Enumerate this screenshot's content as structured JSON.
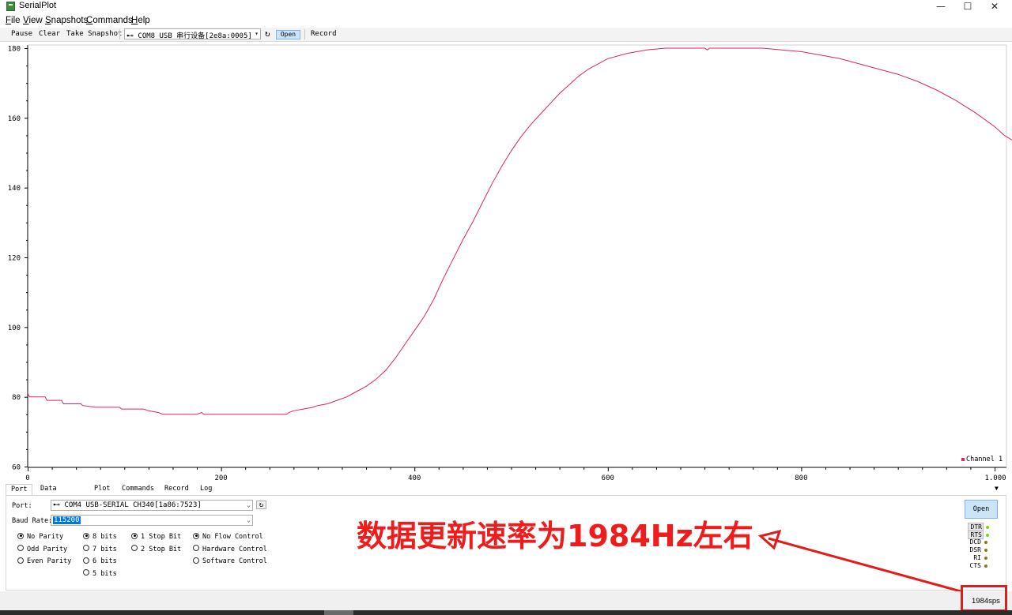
{
  "window": {
    "title": "SerialPlot",
    "min_glyph": "—",
    "max_glyph": "☐",
    "close_glyph": "✕"
  },
  "menu": [
    "File",
    "View",
    "Snapshots",
    "Commands",
    "Help"
  ],
  "toolbar": {
    "pause": "Pause",
    "clear": "Clear",
    "snapshot": "Take Snapshot",
    "port_combo": "⊷ COM8 USB 串行设备[2e8a:0005]",
    "refresh_glyph": "↻",
    "open": "Open",
    "record": "Record"
  },
  "chart_data": {
    "type": "line",
    "xlim": [
      0,
      1000
    ],
    "ylim": [
      60,
      180
    ],
    "x_ticks": [
      0,
      200,
      400,
      600,
      800
    ],
    "x_tick_labels": [
      "0",
      "200",
      "400",
      "600",
      "800",
      "1.000"
    ],
    "y_ticks": [
      60,
      80,
      100,
      120,
      140,
      160,
      180
    ],
    "y_tick_labels": [
      "60",
      "80",
      "100",
      "120",
      "140",
      "160",
      "180"
    ],
    "grid": false,
    "legend_position": "bottom-right",
    "series": [
      {
        "name": "Channel 1",
        "color": "#e0245e",
        "points": [
          [
            0,
            81
          ],
          [
            2,
            80
          ],
          [
            18,
            80
          ],
          [
            20,
            79
          ],
          [
            35,
            79
          ],
          [
            37,
            78
          ],
          [
            55,
            78
          ],
          [
            57,
            77.5
          ],
          [
            65,
            77.2
          ],
          [
            70,
            77
          ],
          [
            95,
            77
          ],
          [
            97,
            76.5
          ],
          [
            120,
            76.5
          ],
          [
            125,
            76
          ],
          [
            135,
            75.5
          ],
          [
            140,
            75
          ],
          [
            175,
            75
          ],
          [
            180,
            75.5
          ],
          [
            182,
            75
          ],
          [
            210,
            75
          ],
          [
            250,
            75
          ],
          [
            268,
            75
          ],
          [
            270,
            75.5
          ],
          [
            275,
            76
          ],
          [
            285,
            76.5
          ],
          [
            295,
            77
          ],
          [
            300,
            77.5
          ],
          [
            310,
            78
          ],
          [
            320,
            79
          ],
          [
            330,
            80
          ],
          [
            340,
            81.5
          ],
          [
            350,
            83
          ],
          [
            360,
            85
          ],
          [
            370,
            87.5
          ],
          [
            380,
            91
          ],
          [
            390,
            95
          ],
          [
            400,
            99
          ],
          [
            410,
            103
          ],
          [
            420,
            108
          ],
          [
            430,
            114
          ],
          [
            440,
            119.5
          ],
          [
            450,
            125
          ],
          [
            460,
            130
          ],
          [
            470,
            135.5
          ],
          [
            480,
            141
          ],
          [
            490,
            146
          ],
          [
            500,
            150.5
          ],
          [
            510,
            154.5
          ],
          [
            520,
            158
          ],
          [
            530,
            161
          ],
          [
            540,
            164
          ],
          [
            550,
            167
          ],
          [
            560,
            169.5
          ],
          [
            570,
            172
          ],
          [
            580,
            174
          ],
          [
            590,
            175.5
          ],
          [
            600,
            177
          ],
          [
            620,
            178.5
          ],
          [
            640,
            179.5
          ],
          [
            660,
            180
          ],
          [
            700,
            180
          ],
          [
            703,
            179.5
          ],
          [
            705,
            180
          ],
          [
            760,
            180
          ],
          [
            780,
            179.5
          ],
          [
            800,
            179
          ],
          [
            820,
            178
          ],
          [
            840,
            177
          ],
          [
            860,
            175.5
          ],
          [
            880,
            174
          ],
          [
            900,
            172.5
          ],
          [
            920,
            170.5
          ],
          [
            940,
            168
          ],
          [
            960,
            165
          ],
          [
            980,
            161.5
          ],
          [
            1000,
            157.5
          ],
          [
            1010,
            155
          ],
          [
            1022,
            153
          ]
        ]
      }
    ]
  },
  "tabs": [
    "Port",
    "Data Format",
    "Plot",
    "Commands",
    "Record",
    "Log"
  ],
  "port_panel": {
    "port_label": "Port:",
    "port_value": "⊷ COM4 USB-SERIAL CH340[1a86:7523]",
    "baud_label": "Baud Rate:",
    "baud_value": "115200",
    "parity": [
      {
        "label": "No Parity",
        "on": true
      },
      {
        "label": "Odd Parity",
        "on": false
      },
      {
        "label": "Even Parity",
        "on": false
      }
    ],
    "data_bits": [
      {
        "label": "8 bits",
        "on": true
      },
      {
        "label": "7 bits",
        "on": false
      },
      {
        "label": "6 bits",
        "on": false
      },
      {
        "label": "5 bits",
        "on": false
      }
    ],
    "stop_bits": [
      {
        "label": "1 Stop Bit",
        "on": true
      },
      {
        "label": "2 Stop Bit",
        "on": false
      }
    ],
    "flow": [
      {
        "label": "No Flow Control",
        "on": true
      },
      {
        "label": "Hardware Control",
        "on": false
      },
      {
        "label": "Software Control",
        "on": false
      }
    ],
    "open": "Open",
    "signals": [
      {
        "name": "DTR",
        "color": "#7ed321",
        "boxed": true
      },
      {
        "name": "RTS",
        "color": "#7ed321",
        "boxed": true
      },
      {
        "name": "DCD",
        "color": "#8a7a18",
        "boxed": false
      },
      {
        "name": "DSR",
        "color": "#8a7a18",
        "boxed": false
      },
      {
        "name": "RI",
        "color": "#8a7a18",
        "boxed": false
      },
      {
        "name": "CTS",
        "color": "#8a7a18",
        "boxed": false
      }
    ]
  },
  "annotation": {
    "text": "数据更新速率为1984Hz左右",
    "color": "#f01c1c"
  },
  "status": {
    "sps": "1984sps"
  }
}
